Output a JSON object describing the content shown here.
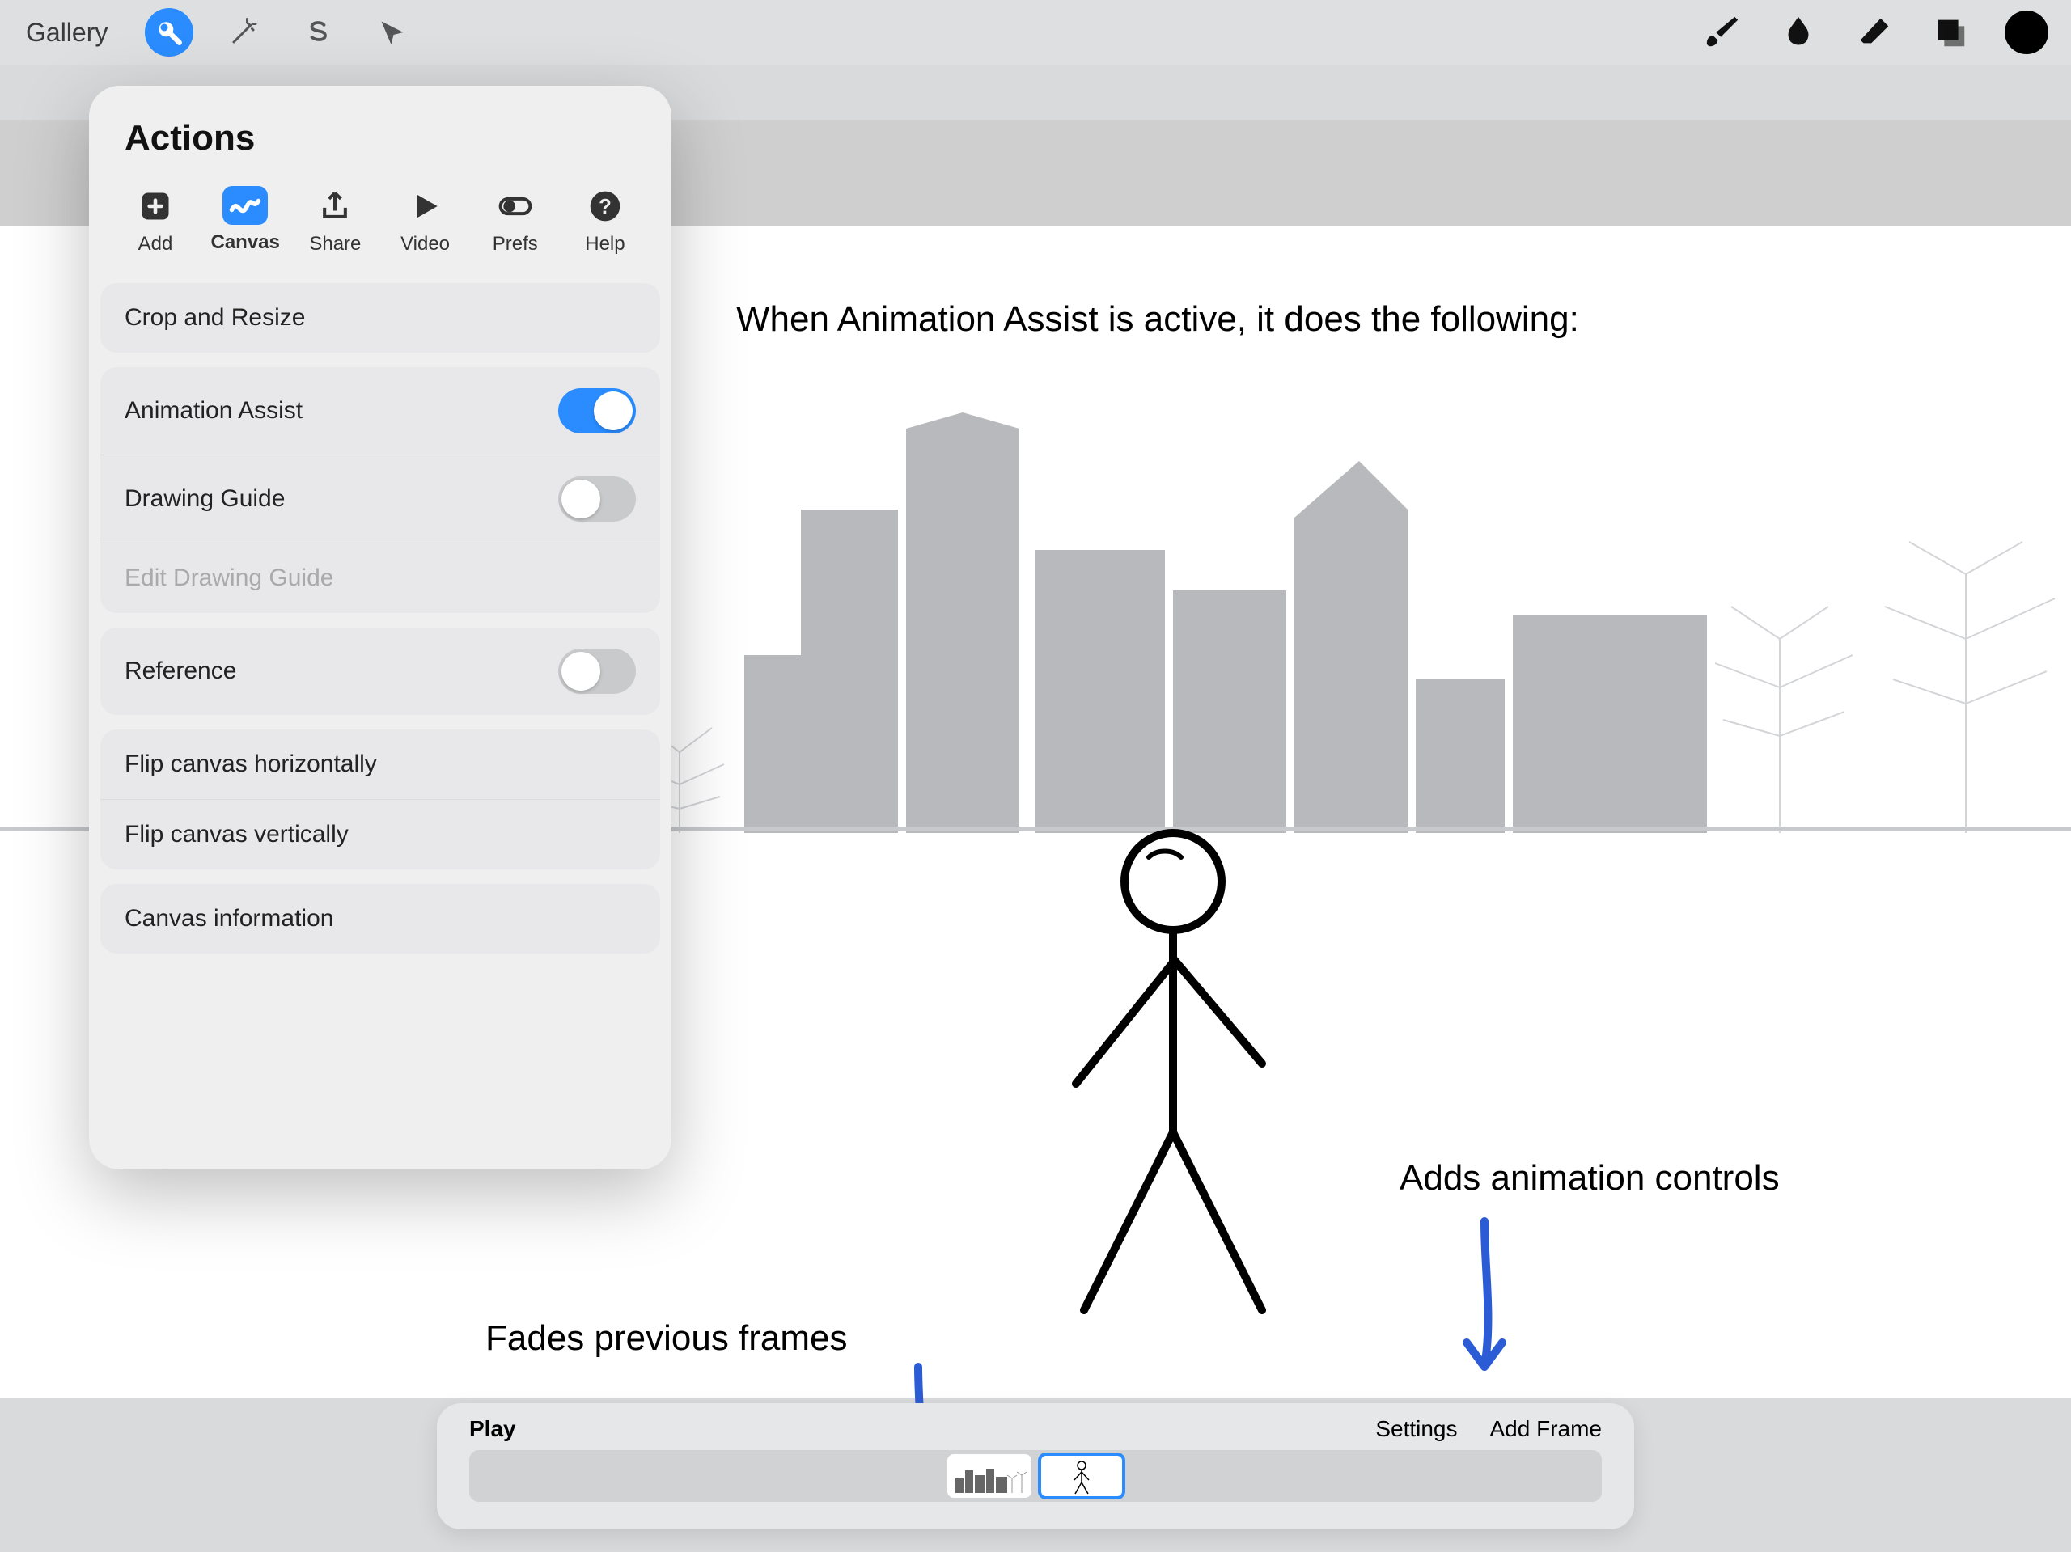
{
  "toolbar": {
    "gallery_label": "Gallery"
  },
  "popover": {
    "title": "Actions",
    "tabs": [
      {
        "label": "Add"
      },
      {
        "label": "Canvas"
      },
      {
        "label": "Share"
      },
      {
        "label": "Video"
      },
      {
        "label": "Prefs"
      },
      {
        "label": "Help"
      }
    ],
    "crop_and_resize": "Crop and Resize",
    "animation_assist": "Animation Assist",
    "animation_assist_on": true,
    "drawing_guide": "Drawing Guide",
    "drawing_guide_on": false,
    "edit_drawing_guide": "Edit Drawing Guide",
    "reference": "Reference",
    "reference_on": false,
    "flip_h": "Flip canvas horizontally",
    "flip_v": "Flip canvas vertically",
    "canvas_info": "Canvas information"
  },
  "annotations": {
    "top": "When Animation Assist is active, it does the following:",
    "right": "Adds animation controls",
    "left": "Fades previous frames"
  },
  "timeline": {
    "play_label": "Play",
    "settings_label": "Settings",
    "add_frame_label": "Add Frame"
  },
  "colors": {
    "accent": "#2a8cff",
    "annotation_arrow": "#2c5bd6"
  }
}
